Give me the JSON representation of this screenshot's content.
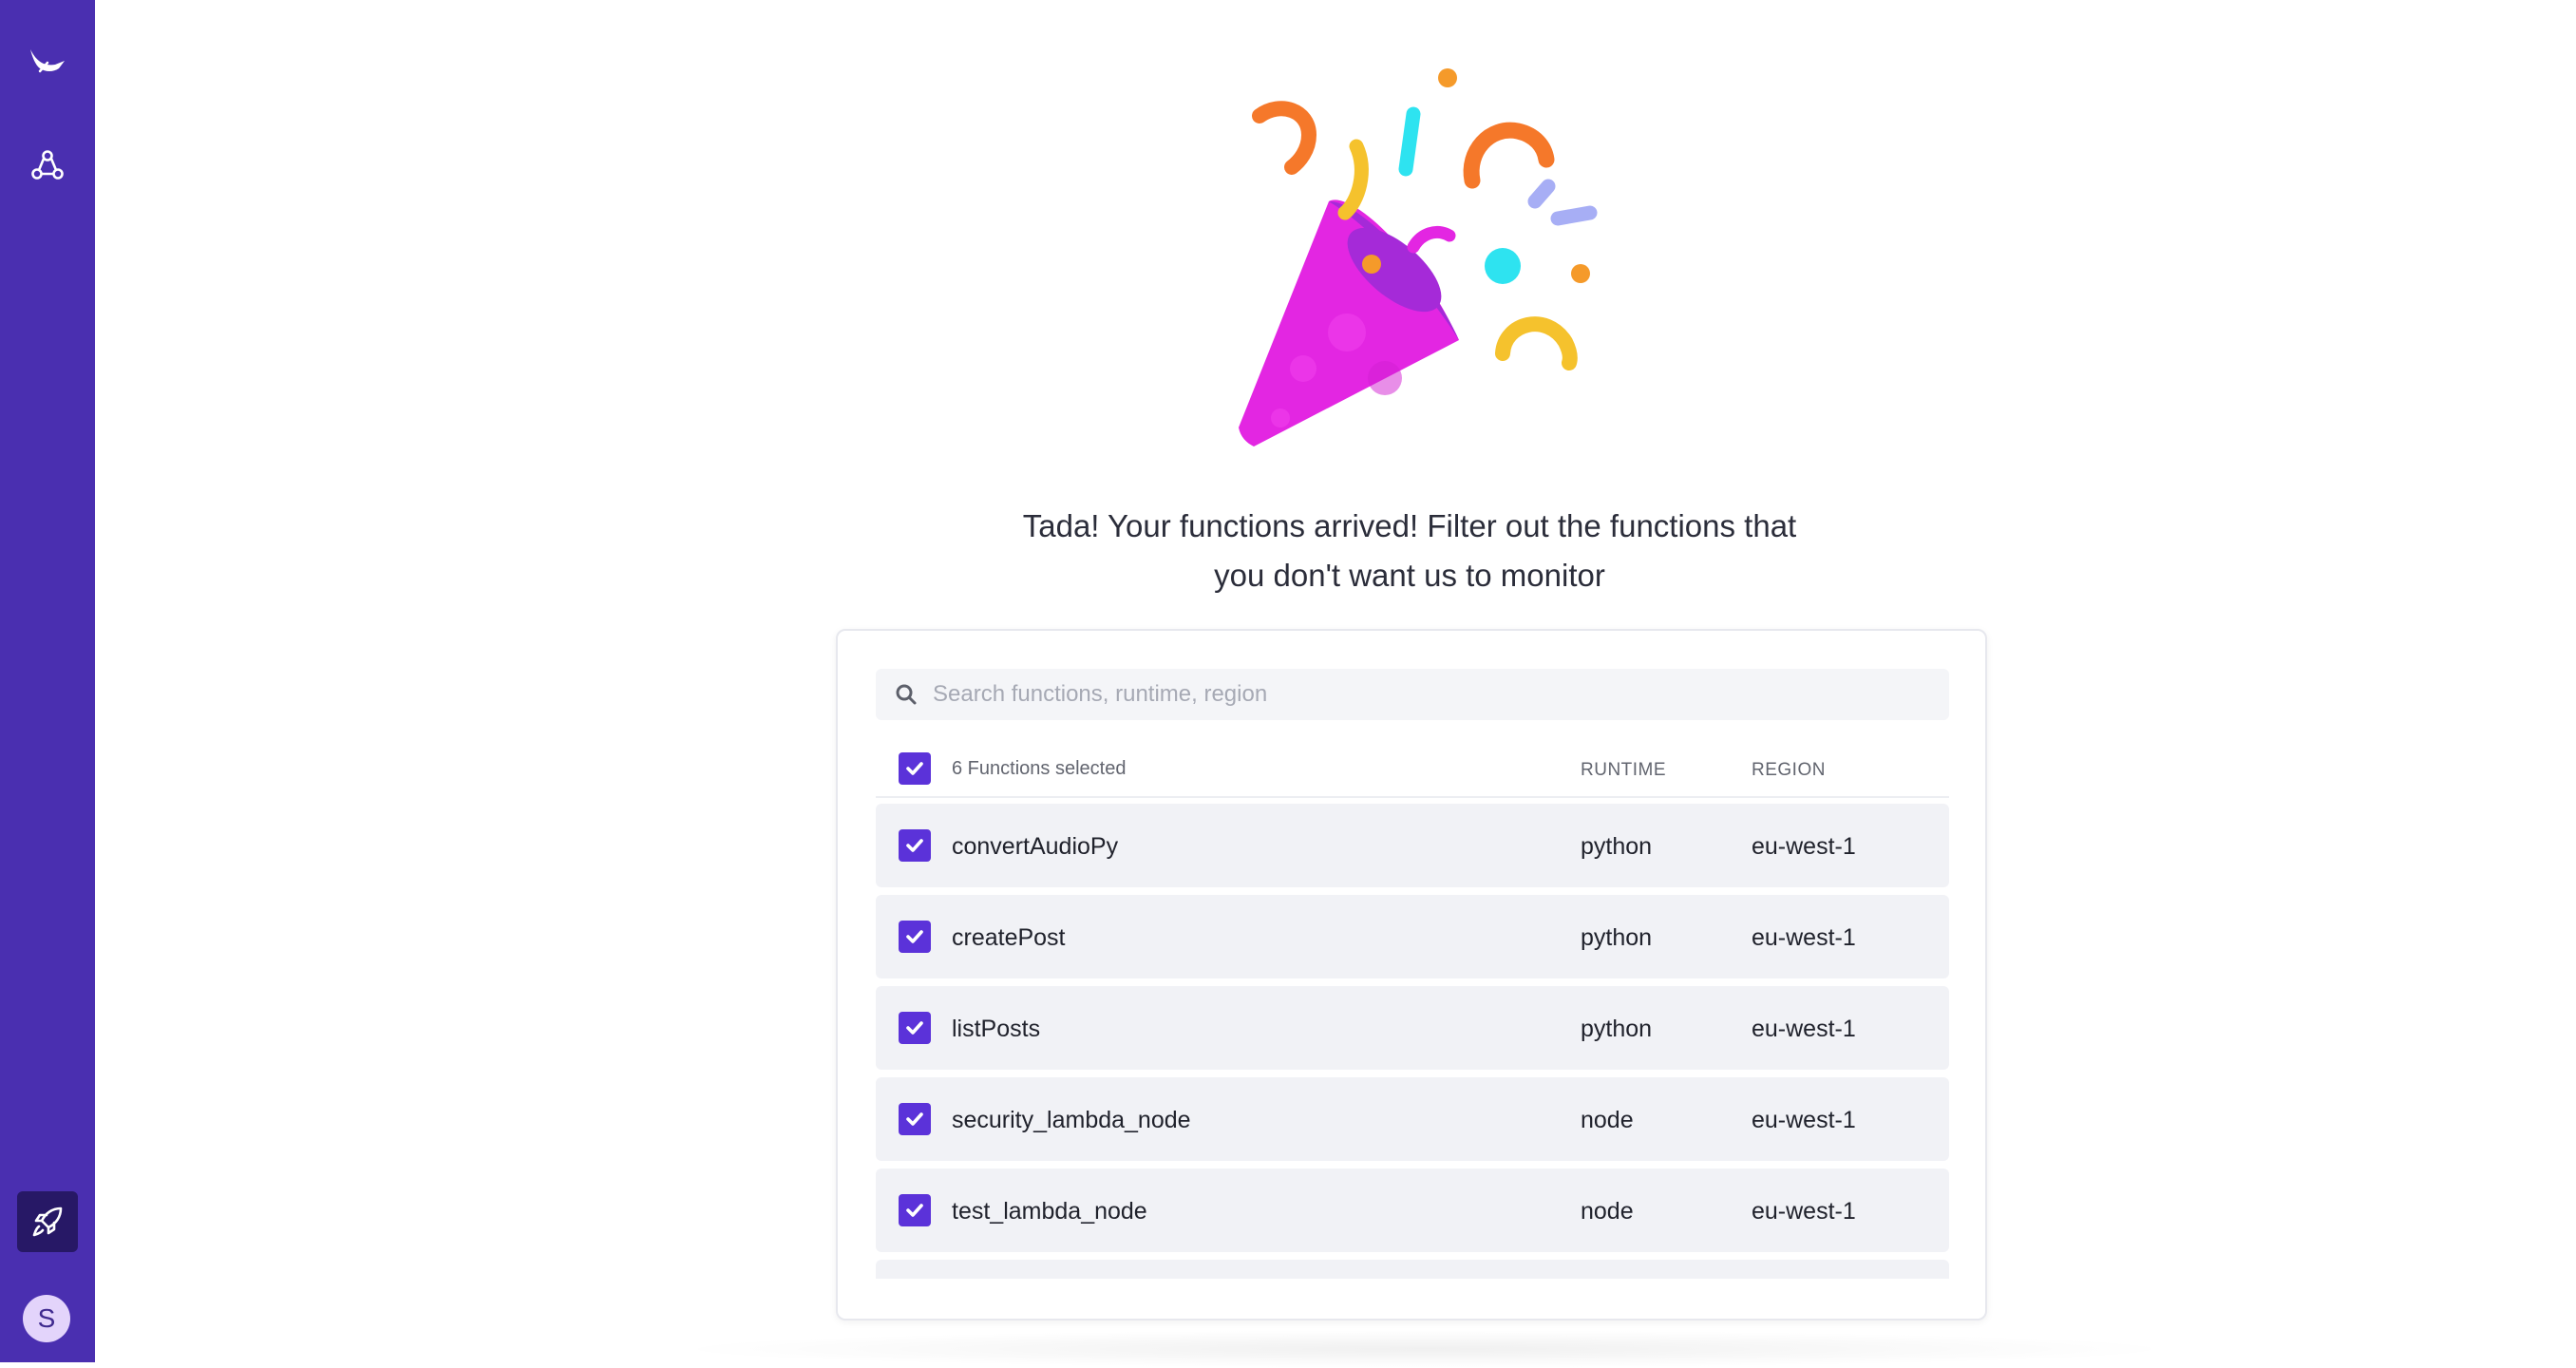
{
  "sidebar": {
    "items": [
      {
        "icon": "bird-logo-icon"
      },
      {
        "icon": "integrations-icon"
      },
      {
        "icon": "rocket-icon"
      }
    ],
    "avatar_letter": "S"
  },
  "heading": {
    "line1": "Tada! Your functions arrived! Filter out the functions that",
    "line2": "you don't want us to monitor"
  },
  "search": {
    "placeholder": "Search functions, runtime, region"
  },
  "table": {
    "selected_label": "6 Functions selected",
    "runtime_header": "RUNTIME",
    "region_header": "REGION",
    "rows": [
      {
        "name": "convertAudioPy",
        "runtime": "python",
        "region": "eu-west-1"
      },
      {
        "name": "createPost",
        "runtime": "python",
        "region": "eu-west-1"
      },
      {
        "name": "listPosts",
        "runtime": "python",
        "region": "eu-west-1"
      },
      {
        "name": "security_lambda_node",
        "runtime": "node",
        "region": "eu-west-1"
      },
      {
        "name": "test_lambda_node",
        "runtime": "node",
        "region": "eu-west-1"
      }
    ]
  },
  "colors": {
    "sidebar": "#4a2fb0",
    "checkbox": "#5b32d9",
    "row_bg": "#f1f2f6"
  }
}
